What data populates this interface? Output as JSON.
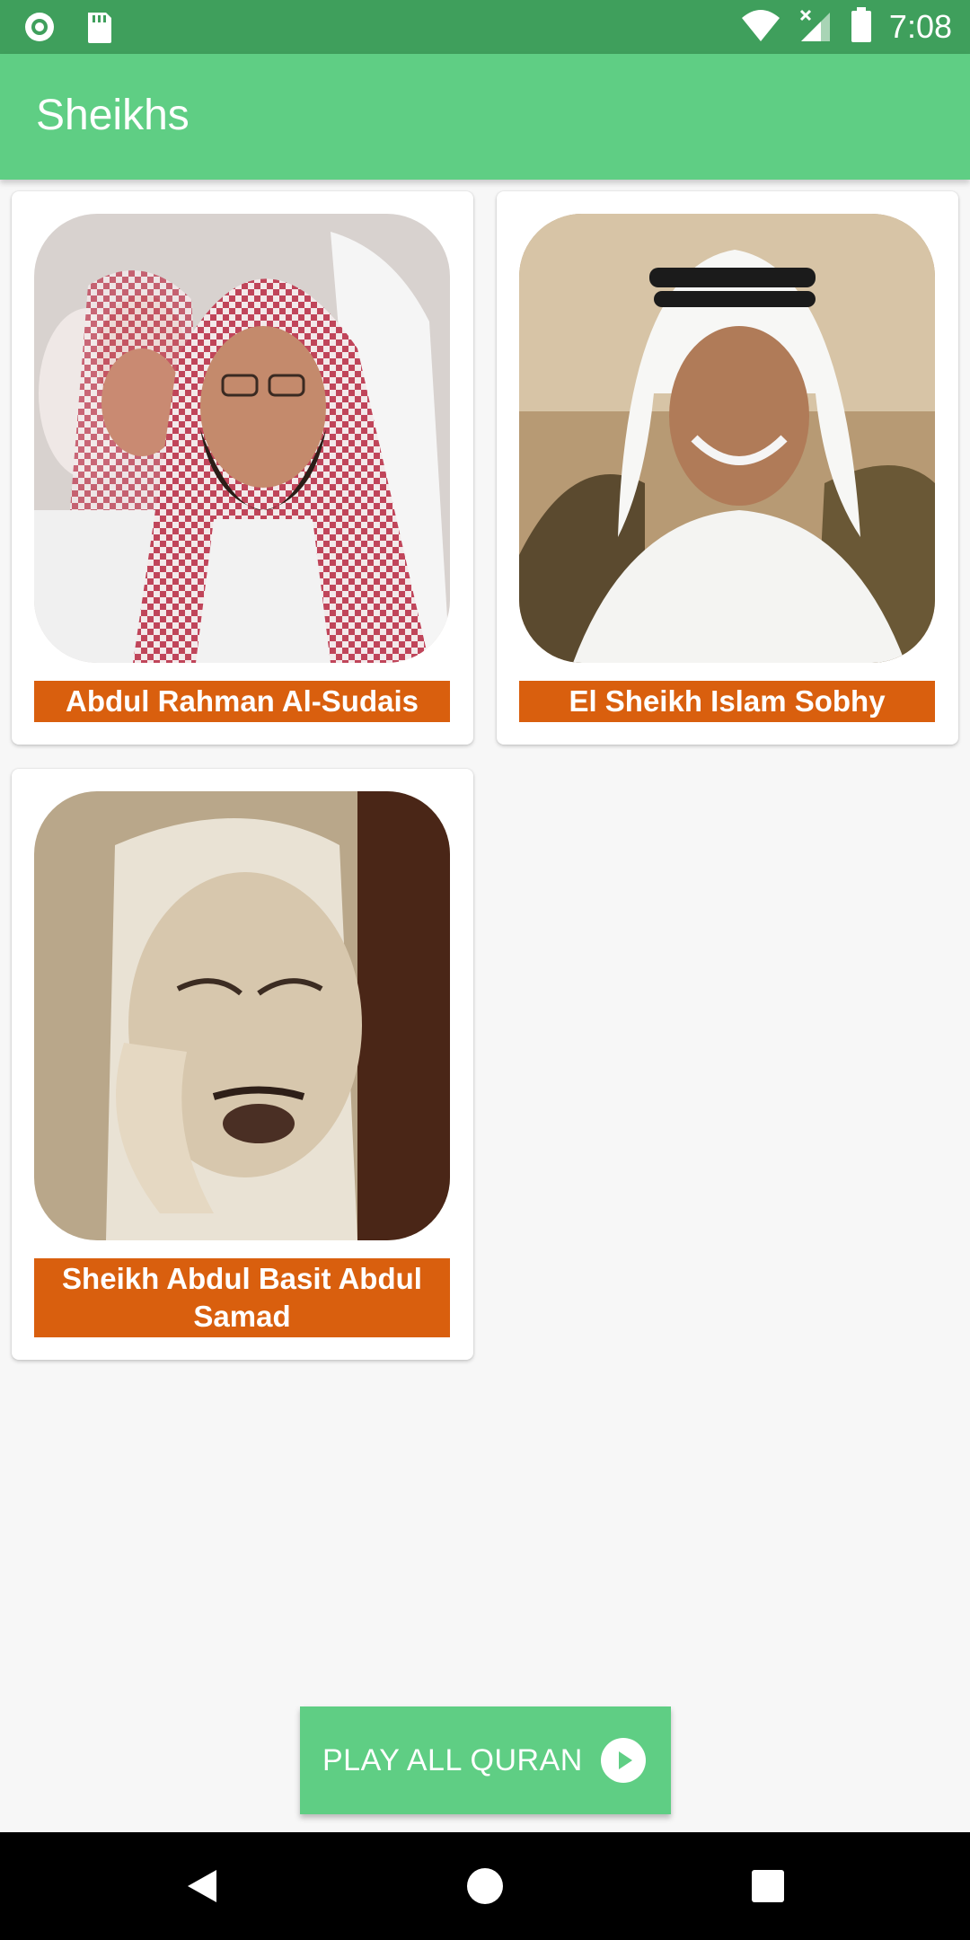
{
  "status_bar": {
    "time": "7:08",
    "icons": [
      "notification-circle-icon",
      "sd-card-icon",
      "wifi-icon",
      "signal-icon",
      "battery-icon"
    ]
  },
  "app_bar": {
    "title": "Sheikhs"
  },
  "sheikhs": [
    {
      "name": "Abdul Rahman Al-Sudais",
      "photo": "sheikh-sudais-photo"
    },
    {
      "name": "El Sheikh Islam Sobhy",
      "photo": "sheikh-islam-sobhy-photo"
    },
    {
      "name": "Sheikh Abdul Basit Abdul Samad",
      "photo": "sheikh-abdul-basit-photo"
    }
  ],
  "play_all": {
    "label": "PLAY ALL QURAN",
    "icon": "play-circle-icon"
  },
  "colors": {
    "status_bar": "#3f9f5c",
    "app_bar": "#5fce84",
    "label_bg": "#d95f0e",
    "background": "#f7f7f7"
  }
}
